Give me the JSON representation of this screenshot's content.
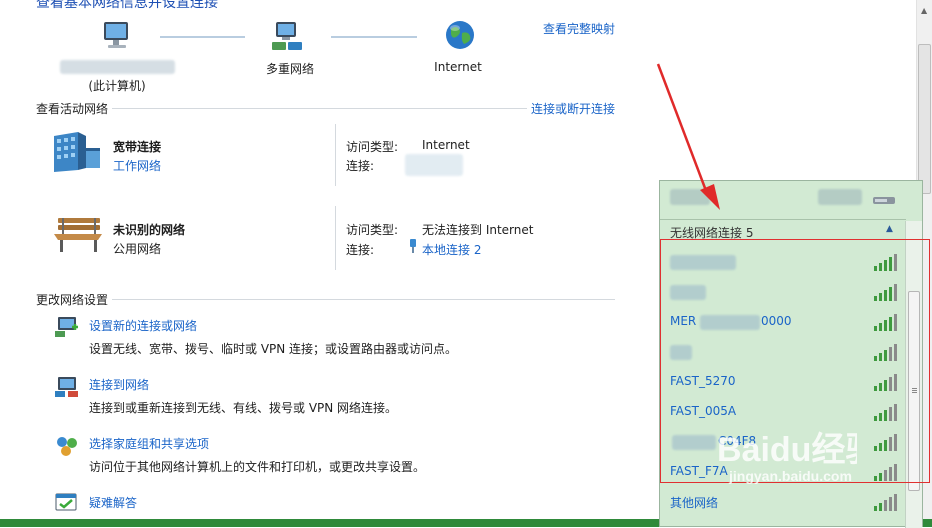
{
  "page": {
    "title": "查看基本网络信息并设置连接",
    "view_full_map": "查看完整映射"
  },
  "network_map": {
    "computer_label": "(此计算机)",
    "middle_label": "多重网络",
    "internet_label": "Internet"
  },
  "active_networks": {
    "section_title": "查看活动网络",
    "connect_disconnect": "连接或断开连接",
    "networks": [
      {
        "name": "宽带连接",
        "type": "工作网络",
        "access_key": "访问类型:",
        "access_value": "Internet",
        "conn_key": "连接:",
        "conn_value": ""
      },
      {
        "name": "未识别的网络",
        "type": "公用网络",
        "access_key": "访问类型:",
        "access_value": "无法连接到 Internet",
        "conn_key": "连接:",
        "conn_value": "本地连接 2"
      }
    ]
  },
  "change_settings": {
    "section_title": "更改网络设置",
    "tasks": [
      {
        "title": "设置新的连接或网络",
        "desc": "设置无线、宽带、拨号、临时或 VPN 连接；或设置路由器或访问点。",
        "icon": "new-connection-icon"
      },
      {
        "title": "连接到网络",
        "desc": "连接到或重新连接到无线、有线、拨号或 VPN 网络连接。",
        "icon": "connect-network-icon"
      },
      {
        "title": "选择家庭组和共享选项",
        "desc": "访问位于其他网络计算机上的文件和打印机，或更改共享设置。",
        "icon": "homegroup-icon"
      },
      {
        "title": "疑难解答",
        "desc": "",
        "icon": "troubleshoot-icon"
      }
    ]
  },
  "wifi_flyout": {
    "group_title": "无线网络连接 5",
    "networks": [
      {
        "label": ""
      },
      {
        "label": ""
      },
      {
        "label": "MER",
        "label_suffix": "0000"
      },
      {
        "label": ""
      },
      {
        "label": "FAST_5270"
      },
      {
        "label": "FAST_005A"
      },
      {
        "label": "",
        "label_suffix": "C04F8"
      },
      {
        "label": "FAST_F7A"
      },
      {
        "label": "其他网络"
      }
    ]
  },
  "watermark": "Baidu经验",
  "watermark_sub": "jingyan.baidu.com",
  "colors": {
    "link": "#1a64c8",
    "flyout_bg": "#d2ead3",
    "highlight_box": "#e03030",
    "signal": "#3e9a3e"
  }
}
